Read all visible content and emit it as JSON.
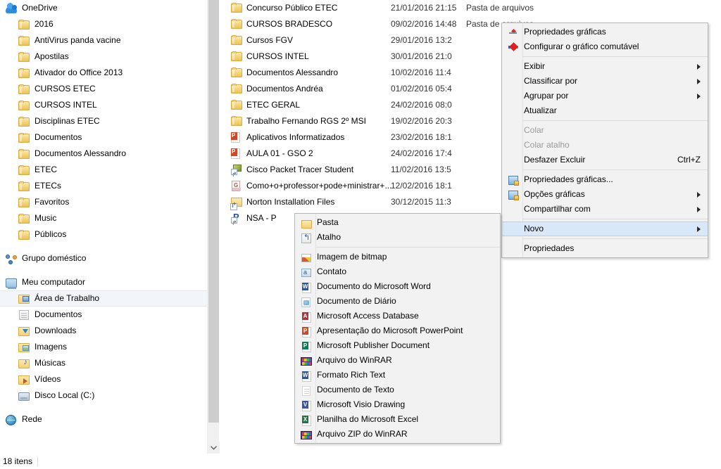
{
  "nav": {
    "groups": [
      {
        "header": {
          "label": "OneDrive",
          "icon": "cloud-icon"
        },
        "items": [
          {
            "label": "2016",
            "icon": "folder-icon"
          },
          {
            "label": "AntiVirus panda vacine",
            "icon": "folder-icon"
          },
          {
            "label": "Apostilas",
            "icon": "folder-icon"
          },
          {
            "label": "Ativador do Office 2013",
            "icon": "folder-icon"
          },
          {
            "label": "CURSOS ETEC",
            "icon": "folder-icon"
          },
          {
            "label": "CURSOS INTEL",
            "icon": "folder-icon"
          },
          {
            "label": "Disciplinas ETEC",
            "icon": "folder-icon"
          },
          {
            "label": "Documentos",
            "icon": "folder-icon"
          },
          {
            "label": "Documentos Alessandro",
            "icon": "folder-icon"
          },
          {
            "label": "ETEC",
            "icon": "folder-icon"
          },
          {
            "label": "ETECs",
            "icon": "folder-icon"
          },
          {
            "label": "Favoritos",
            "icon": "folder-icon"
          },
          {
            "label": "Music",
            "icon": "folder-icon"
          },
          {
            "label": "Públicos",
            "icon": "folder-icon"
          }
        ]
      },
      {
        "header": {
          "label": "Grupo doméstico",
          "icon": "homegroup-icon"
        },
        "items": []
      },
      {
        "header": {
          "label": "Meu computador",
          "icon": "computer-icon"
        },
        "items": [
          {
            "label": "Área de Trabalho",
            "icon": "desktop-folder-icon",
            "selected": true
          },
          {
            "label": "Documentos",
            "icon": "documents-folder-icon"
          },
          {
            "label": "Downloads",
            "icon": "downloads-folder-icon"
          },
          {
            "label": "Imagens",
            "icon": "pictures-folder-icon"
          },
          {
            "label": "Músicas",
            "icon": "music-folder-icon"
          },
          {
            "label": "Vídeos",
            "icon": "videos-folder-icon"
          },
          {
            "label": "Disco Local (C:)",
            "icon": "drive-icon"
          }
        ]
      },
      {
        "header": {
          "label": "Rede",
          "icon": "network-icon"
        },
        "items": []
      }
    ]
  },
  "status": {
    "item_count": "18 itens"
  },
  "files": {
    "rows": [
      {
        "name": "Concurso Público ETEC",
        "date": "21/01/2016 21:15",
        "type": "Pasta de arquivos",
        "icon": "folder-icon"
      },
      {
        "name": "CURSOS BRADESCO",
        "date": "09/02/2016 14:48",
        "type": "Pasta de arquivos",
        "icon": "folder-icon"
      },
      {
        "name": "Cursos FGV",
        "date": "29/01/2016 13:2",
        "type": "",
        "icon": "folder-icon"
      },
      {
        "name": "CURSOS INTEL",
        "date": "30/01/2016 21:0",
        "type": "",
        "icon": "folder-icon"
      },
      {
        "name": "Documentos Alessandro",
        "date": "10/02/2016 11:4",
        "type": "",
        "icon": "folder-icon"
      },
      {
        "name": "Documentos Andréa",
        "date": "01/02/2016 05:4",
        "type": "",
        "icon": "folder-icon"
      },
      {
        "name": "ETEC GERAL",
        "date": "24/02/2016 08:0",
        "type": "",
        "icon": "folder-icon"
      },
      {
        "name": "Trabalho Fernando RGS 2º MSI",
        "date": "19/02/2016 20:3",
        "type": "",
        "icon": "folder-icon"
      },
      {
        "name": "Aplicativos Informatizados",
        "date": "23/02/2016 18:1",
        "type": "",
        "icon": "powerpoint-icon"
      },
      {
        "name": "AULA 01 - GSO 2",
        "date": "24/02/2016 17:4",
        "type": "",
        "icon": "powerpoint-icon"
      },
      {
        "name": "Cisco Packet Tracer Student",
        "date": "11/02/2016 13:5",
        "type": "",
        "icon": "packet-tracer-shortcut-icon"
      },
      {
        "name": "Como+o+professor+pode+ministrar+...",
        "date": "12/02/2016 18:1",
        "type": "",
        "icon": "pdf-icon"
      },
      {
        "name": "Norton Installation Files",
        "date": "30/12/2015 11:3",
        "type": "",
        "icon": "folder-shortcut-icon"
      },
      {
        "name": "NSA - P",
        "date": "",
        "type": "",
        "icon": "nsa-shortcut-icon"
      }
    ]
  },
  "context_menu": {
    "items": [
      {
        "label": "Propriedades gráficas",
        "icon": "graphics-properties-icon",
        "type": "item"
      },
      {
        "label": "Configurar o gráfico comutável",
        "icon": "switchable-graphics-icon",
        "type": "item"
      },
      {
        "type": "separator"
      },
      {
        "label": "Exibir",
        "type": "submenu"
      },
      {
        "label": "Classificar por",
        "type": "submenu"
      },
      {
        "label": "Agrupar por",
        "type": "submenu"
      },
      {
        "label": "Atualizar",
        "type": "item"
      },
      {
        "type": "separator"
      },
      {
        "label": "Colar",
        "type": "item",
        "disabled": true
      },
      {
        "label": "Colar atalho",
        "type": "item",
        "disabled": true
      },
      {
        "label": "Desfazer Excluir",
        "type": "item",
        "accel": "Ctrl+Z"
      },
      {
        "type": "separator"
      },
      {
        "label": "Propriedades gráficas...",
        "icon": "monitor-icon",
        "type": "item"
      },
      {
        "label": "Opções gráficas",
        "icon": "monitor-icon",
        "type": "submenu"
      },
      {
        "label": "Compartilhar com",
        "type": "submenu"
      },
      {
        "type": "separator"
      },
      {
        "label": "Novo",
        "type": "submenu",
        "highlighted": true
      },
      {
        "type": "separator"
      },
      {
        "label": "Propriedades",
        "type": "item"
      }
    ]
  },
  "submenu": {
    "items": [
      {
        "label": "Pasta",
        "icon": "folder-icon"
      },
      {
        "label": "Atalho",
        "icon": "shortcut-icon"
      },
      {
        "type": "separator"
      },
      {
        "label": "Imagem de bitmap",
        "icon": "bitmap-image-icon"
      },
      {
        "label": "Contato",
        "icon": "contact-icon"
      },
      {
        "label": "Documento do Microsoft Word",
        "icon": "word-document-icon"
      },
      {
        "label": "Documento de Diário",
        "icon": "journal-document-icon"
      },
      {
        "label": "Microsoft Access Database",
        "icon": "access-database-icon"
      },
      {
        "label": "Apresentação do Microsoft PowerPoint",
        "icon": "powerpoint-presentation-icon"
      },
      {
        "label": "Microsoft Publisher Document",
        "icon": "publisher-document-icon"
      },
      {
        "label": "Arquivo do WinRAR",
        "icon": "winrar-archive-icon"
      },
      {
        "label": "Formato Rich Text",
        "icon": "rich-text-icon"
      },
      {
        "label": "Documento de Texto",
        "icon": "text-document-icon"
      },
      {
        "label": "Microsoft Visio Drawing",
        "icon": "visio-drawing-icon"
      },
      {
        "label": "Planilha do Microsoft Excel",
        "icon": "excel-spreadsheet-icon"
      },
      {
        "label": "Arquivo ZIP do WinRAR",
        "icon": "winrar-zip-icon"
      }
    ]
  },
  "colors": {
    "highlight": "#d8e8f8",
    "menu_bg": "#f2f2f2",
    "menu_border": "#b6b6b6",
    "selection_row": "#f2f6fb",
    "disabled_text": "#9a9a9a"
  }
}
